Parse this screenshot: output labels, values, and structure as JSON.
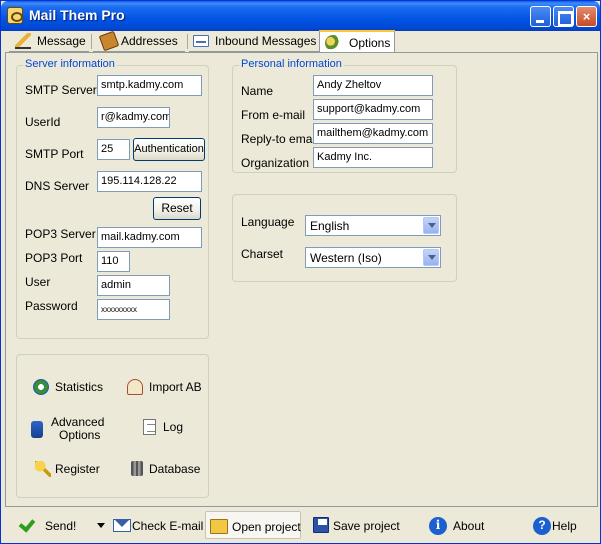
{
  "window": {
    "title": "Mail Them Pro"
  },
  "tabs": [
    {
      "label": "Message",
      "icon": "pencil-icon"
    },
    {
      "label": "Addresses",
      "icon": "address-book-icon"
    },
    {
      "label": "Inbound Messages",
      "icon": "inbox-icon"
    },
    {
      "label": "Options",
      "icon": "gears-icon",
      "active": true
    }
  ],
  "server": {
    "group_title": "Server information",
    "smtp_server_label": "SMTP Server",
    "smtp_server_value": "smtp.kadmy.com",
    "userid_label": "UserId",
    "userid_value": "r@kadmy.com",
    "smtp_port_label": "SMTP Port",
    "smtp_port_value": "25",
    "authentication_button": "Authentication",
    "dns_server_label": "DNS Server",
    "dns_server_value": "195.114.128.22",
    "reset_button": "Reset",
    "pop3_server_label": "POP3 Server",
    "pop3_server_value": "mail.kadmy.com",
    "pop3_port_label": "POP3 Port",
    "pop3_port_value": "110",
    "user_label": "User",
    "user_value": "admin",
    "password_label": "Password",
    "password_value": "xxxxxxxxx"
  },
  "personal": {
    "group_title": "Personal information",
    "name_label": "Name",
    "name_value": "Andy Zheltov",
    "from_label": "From e-mail",
    "from_value": "support@kadmy.com",
    "reply_label": "Reply-to email",
    "reply_value": "mailthem@kadmy.com",
    "org_label": "Organization",
    "org_value": "Kadmy Inc."
  },
  "locale": {
    "language_label": "Language",
    "language_value": "English",
    "charset_label": "Charset",
    "charset_value": "Western (Iso)"
  },
  "actions": {
    "statistics": "Statistics",
    "import_ab": "Import AB",
    "advanced_line1": "Advanced",
    "advanced_line2": "Options",
    "log": "Log",
    "register": "Register",
    "database": "Database"
  },
  "toolbar": {
    "send": "Send!",
    "check_email": "Check E-mail",
    "open_project": "Open project",
    "save_project": "Save project",
    "about": "About",
    "help": "Help",
    "about_glyph": "i",
    "help_glyph": "?"
  },
  "colors": {
    "titlebar": "#0054E3",
    "group_title": "#0046D5",
    "background": "#ECE9D8"
  }
}
